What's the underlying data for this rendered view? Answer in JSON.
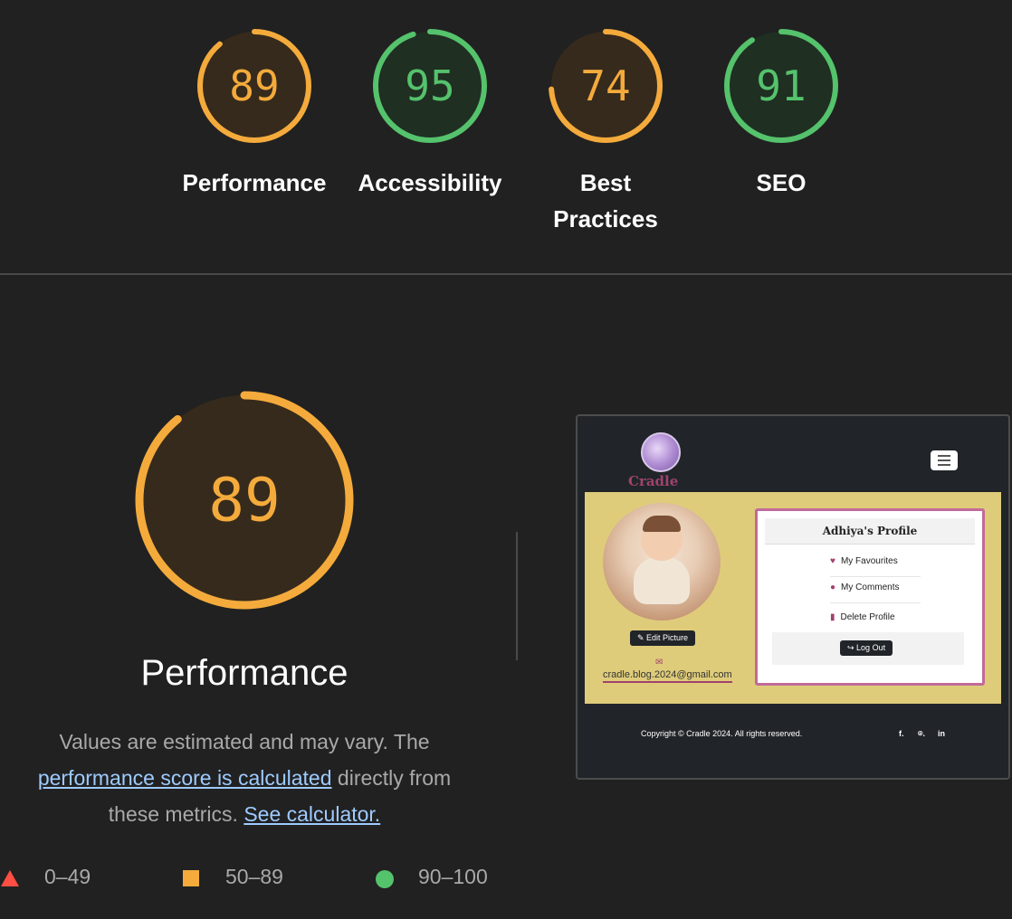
{
  "categories": [
    {
      "score": "89",
      "value": 89,
      "label_lines": [
        "Performance"
      ],
      "color": "#f4ab3c",
      "bg": "#362a1c"
    },
    {
      "score": "95",
      "value": 95,
      "label_lines": [
        "Accessibility"
      ],
      "color": "#55c26c",
      "bg": "#1f2f22"
    },
    {
      "score": "74",
      "value": 74,
      "label_lines": [
        "Best",
        "Practices"
      ],
      "color": "#f4ab3c",
      "bg": "#362a1c"
    },
    {
      "score": "91",
      "value": 91,
      "label_lines": [
        "SEO"
      ],
      "color": "#55c26c",
      "bg": "#1f2f22"
    }
  ],
  "performance": {
    "score": "89",
    "value": 89,
    "title": "Performance",
    "desc_part1": "Values are estimated and may vary. The ",
    "desc_link1": "performance score is calculated",
    "desc_part2": " directly from these metrics. ",
    "desc_link2": "See calculator."
  },
  "legend": {
    "fail": "0–49",
    "average": "50–89",
    "pass": "90–100"
  },
  "screenshot": {
    "brand": "Cradle",
    "edit_button": "Edit Picture",
    "email": "cradle.blog.2024@gmail.com",
    "profile_title": "Adhiya's Profile",
    "menu": [
      "My Favourites",
      "My Comments",
      "Delete Profile"
    ],
    "logout": "Log Out",
    "copyright": "Copyright © Cradle 2024. All rights reserved.",
    "social": [
      "f.",
      "⌾.",
      "in"
    ]
  },
  "colors": {
    "fail": "#ff4e42",
    "average": "#f4ab3c",
    "pass": "#55c26c",
    "link": "#9ecbff"
  }
}
